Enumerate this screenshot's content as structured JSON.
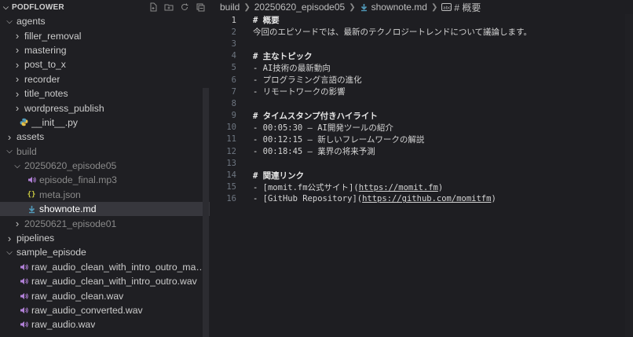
{
  "explorer": {
    "root": "PODFLOWER",
    "items": [
      {
        "label": "agents",
        "kind": "folder",
        "open": true,
        "depth": 0
      },
      {
        "label": "filler_removal",
        "kind": "folder",
        "open": false,
        "depth": 1
      },
      {
        "label": "mastering",
        "kind": "folder",
        "open": false,
        "depth": 1
      },
      {
        "label": "post_to_x",
        "kind": "folder",
        "open": false,
        "depth": 1
      },
      {
        "label": "recorder",
        "kind": "folder",
        "open": false,
        "depth": 1
      },
      {
        "label": "title_notes",
        "kind": "folder",
        "open": false,
        "depth": 1
      },
      {
        "label": "wordpress_publish",
        "kind": "folder",
        "open": false,
        "depth": 1
      },
      {
        "label": "__init__.py",
        "kind": "python",
        "depth": 1
      },
      {
        "label": "assets",
        "kind": "folder",
        "open": false,
        "depth": 0
      },
      {
        "label": "build",
        "kind": "folder",
        "open": true,
        "depth": 0,
        "dim": true
      },
      {
        "label": "20250620_episode05",
        "kind": "folder",
        "open": true,
        "depth": 1,
        "dim": true
      },
      {
        "label": "episode_final.mp3",
        "kind": "audio",
        "depth": 2,
        "dim": true
      },
      {
        "label": "meta.json",
        "kind": "json",
        "depth": 2,
        "dim": true
      },
      {
        "label": "shownote.md",
        "kind": "markdown",
        "depth": 2,
        "selected": true
      },
      {
        "label": "20250621_episode01",
        "kind": "folder",
        "open": false,
        "depth": 1,
        "dim": true
      },
      {
        "label": "pipelines",
        "kind": "folder",
        "open": false,
        "depth": 0
      },
      {
        "label": "sample_episode",
        "kind": "folder",
        "open": true,
        "depth": 0
      },
      {
        "label": "raw_audio_clean_with_intro_outro_mastere...",
        "kind": "audio",
        "depth": 1
      },
      {
        "label": "raw_audio_clean_with_intro_outro.wav",
        "kind": "audio",
        "depth": 1
      },
      {
        "label": "raw_audio_clean.wav",
        "kind": "audio",
        "depth": 1
      },
      {
        "label": "raw_audio_converted.wav",
        "kind": "audio",
        "depth": 1
      },
      {
        "label": "raw_audio.wav",
        "kind": "audio",
        "depth": 1
      }
    ]
  },
  "breadcrumb": {
    "parts": [
      "build",
      "20250620_episode05",
      "shownote.md",
      "# 概要"
    ]
  },
  "editor": {
    "active_line": 1,
    "lines": [
      {
        "n": "1",
        "segs": [
          [
            "kw",
            "# 概要"
          ]
        ]
      },
      {
        "n": "2",
        "segs": [
          [
            "p",
            "今回のエピソードでは、最新のテクノロジートレンドについて議論します。"
          ]
        ]
      },
      {
        "n": "3",
        "segs": []
      },
      {
        "n": "4",
        "segs": [
          [
            "kw",
            "# 主なトピック"
          ]
        ]
      },
      {
        "n": "5",
        "segs": [
          [
            "bl",
            "- "
          ],
          [
            "p",
            "AI技術の最新動向"
          ]
        ]
      },
      {
        "n": "6",
        "segs": [
          [
            "bl",
            "- "
          ],
          [
            "p",
            "プログラミング言語の進化"
          ]
        ]
      },
      {
        "n": "7",
        "segs": [
          [
            "bl",
            "- "
          ],
          [
            "p",
            "リモートワークの影響"
          ]
        ]
      },
      {
        "n": "8",
        "segs": []
      },
      {
        "n": "9",
        "segs": [
          [
            "kw",
            "# タイムスタンプ付きハイライト"
          ]
        ]
      },
      {
        "n": "10",
        "segs": [
          [
            "bl",
            "- "
          ],
          [
            "p",
            "00:05:30 – AI開発ツールの紹介"
          ]
        ]
      },
      {
        "n": "11",
        "segs": [
          [
            "bl",
            "- "
          ],
          [
            "p",
            "00:12:15 – 新しいフレームワークの解説"
          ]
        ]
      },
      {
        "n": "12",
        "segs": [
          [
            "bl",
            "- "
          ],
          [
            "p",
            "00:18:45 – 業界の将来予測"
          ]
        ]
      },
      {
        "n": "13",
        "segs": []
      },
      {
        "n": "14",
        "segs": [
          [
            "kw",
            "# 関連リンク"
          ]
        ]
      },
      {
        "n": "15",
        "segs": [
          [
            "bl",
            "- "
          ],
          [
            "p",
            "[momit.fm公式サイト]("
          ],
          [
            "u",
            "https://momit.fm"
          ],
          [
            "p",
            ")"
          ]
        ]
      },
      {
        "n": "16",
        "segs": [
          [
            "bl",
            "- "
          ],
          [
            "p",
            "[GitHub Repository]("
          ],
          [
            "u",
            "https://github.com/momitfm"
          ],
          [
            "p",
            ")"
          ]
        ]
      }
    ]
  },
  "colors": {
    "audio_icon": "#b180d7",
    "json_icon": "#cbcb41",
    "python_icon": "#519aba",
    "markdown_icon": "#519aba"
  }
}
